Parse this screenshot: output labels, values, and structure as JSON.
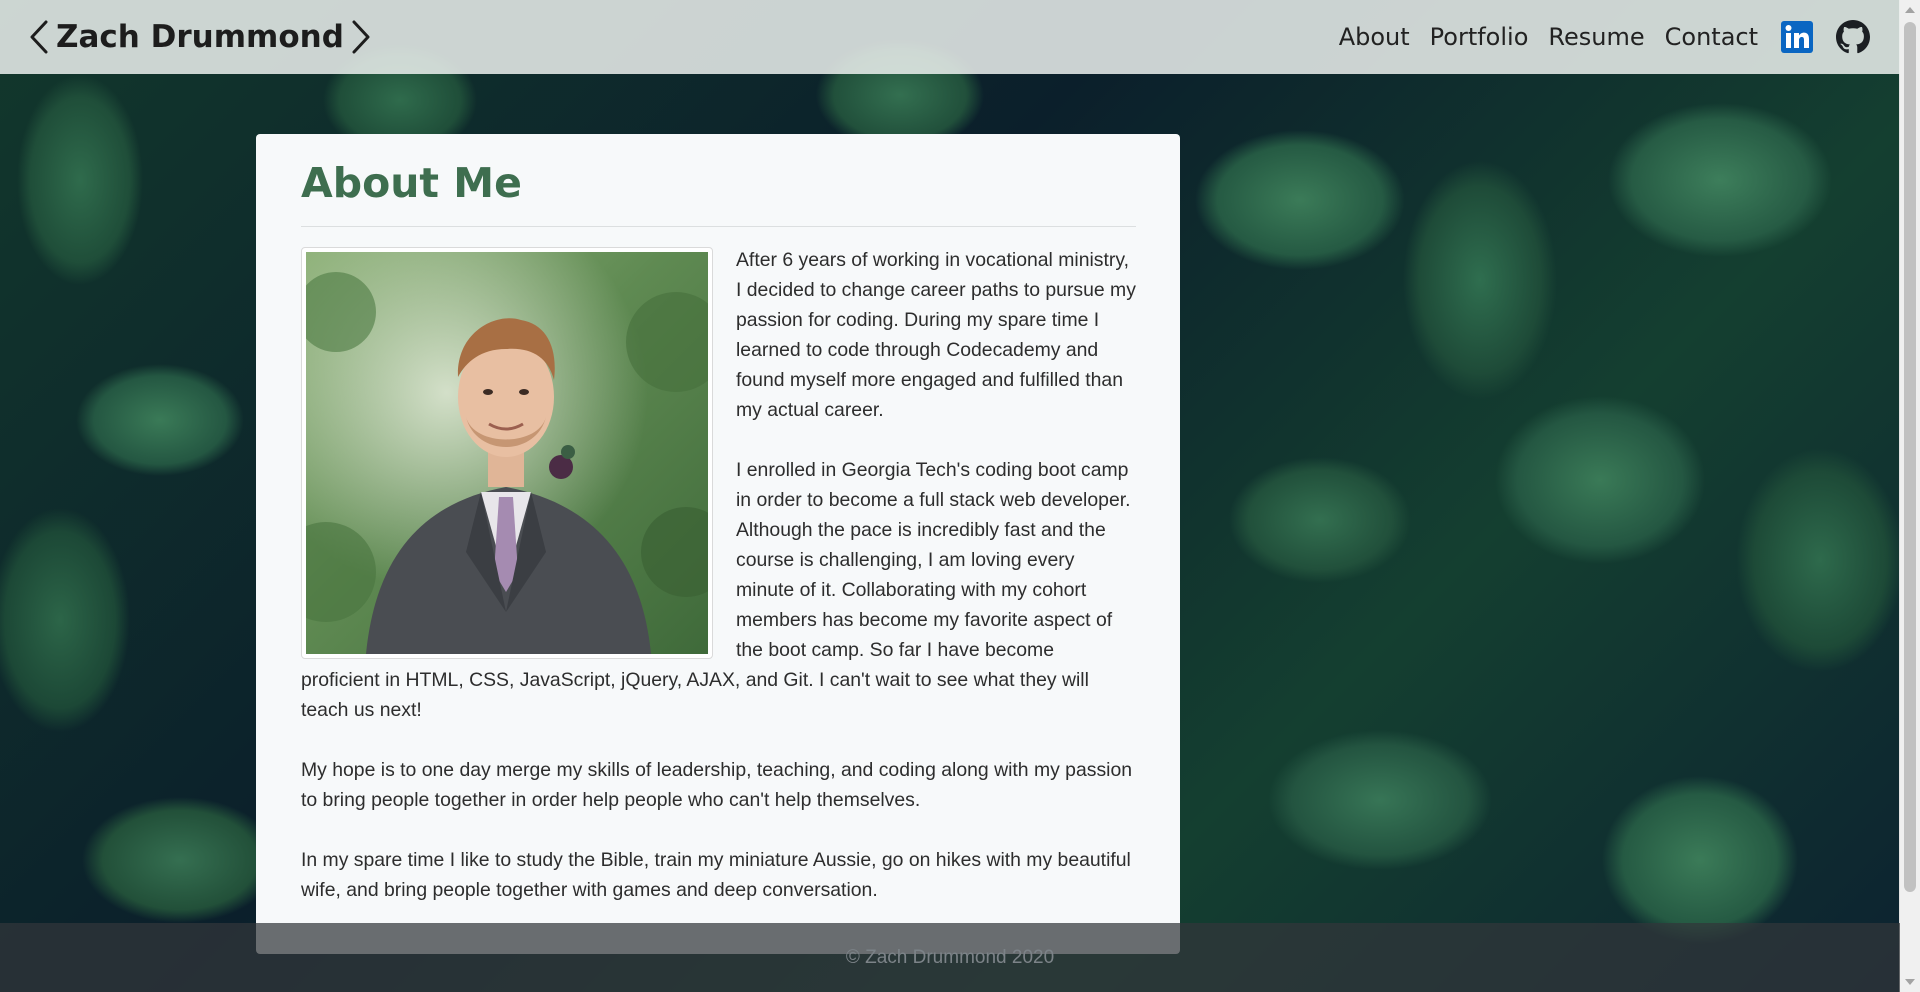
{
  "header": {
    "brand": "Zach Drummond",
    "nav": [
      "About",
      "Portfolio",
      "Resume",
      "Contact"
    ],
    "icons": [
      "linkedin-icon",
      "github-icon"
    ],
    "colors": {
      "linkedin": "#0a66c2",
      "github": "#1b1f23"
    }
  },
  "about": {
    "title": "About Me",
    "paragraphs": [
      "After 6 years of working in vocational ministry, I decided to change career paths to pursue my passion for coding. During my spare time I learned to code through Codecademy and found myself more engaged and fulfilled than my actual career.",
      "I enrolled in Georgia Tech's coding boot camp in order to become a full stack web developer. Although the pace is incredibly fast and the course is challenging, I am loving every minute of it. Collaborating with my cohort members has become my favorite aspect of the boot camp. So far I have become proficient in HTML, CSS, JavaScript, jQuery, AJAX, and Git. I can't wait to see what they will teach us next!",
      "My hope is to one day merge my skills of leadership, teaching, and coding along with my passion to bring people together in order help people who can't help themselves.",
      "In my spare time I like to study the Bible, train my miniature Aussie, go on hikes with my beautiful wife, and bring people together with games and deep conversation."
    ],
    "title_color": "#3e6e4f"
  },
  "footer": {
    "text": "© Zach Drummond 2020"
  }
}
